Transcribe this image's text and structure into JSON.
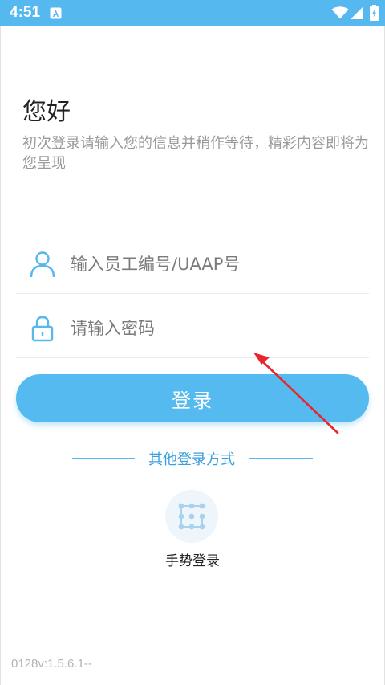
{
  "status_bar": {
    "time": "4:51",
    "notification_icon": "a-app-icon",
    "wifi_icon": "wifi-icon",
    "signal_icon": "signal-icon",
    "battery_icon": "battery-charging-icon",
    "background_color": "#55b8ef"
  },
  "header": {
    "greeting": "您好",
    "subtitle": "初次登录请输入您的信息并稍作等待，精彩内容即将为您呈现"
  },
  "form": {
    "username": {
      "placeholder": "输入员工编号/UAAP号",
      "value": "",
      "icon": "user-icon"
    },
    "password": {
      "placeholder": "请输入密码",
      "value": "",
      "icon": "lock-icon"
    },
    "login_label": "登录"
  },
  "other_login": {
    "label": "其他登录方式",
    "gesture_label": "手势登录",
    "gesture_icon": "gesture-grid-icon"
  },
  "footer": {
    "version": "0128v:1.5.6.1--"
  },
  "annotation": {
    "arrow_icon": "red-arrow-icon",
    "color": "#e8262b"
  },
  "colors": {
    "accent": "#55baf0",
    "accent_text": "#3a9fe0",
    "placeholder": "#7a7a7a",
    "subtitle": "#9a9a9a"
  }
}
